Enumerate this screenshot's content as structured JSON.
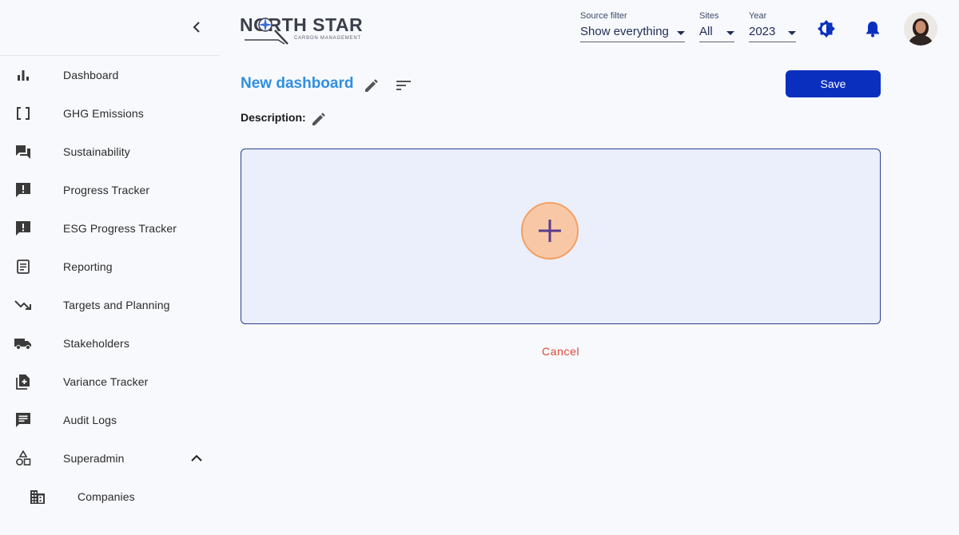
{
  "sidebar": {
    "items": [
      {
        "label": "Dashboard",
        "icon": "bar-chart-icon"
      },
      {
        "label": "GHG Emissions",
        "icon": "brackets-icon"
      },
      {
        "label": "Sustainability",
        "icon": "forum-icon"
      },
      {
        "label": "Progress Tracker",
        "icon": "feedback-icon"
      },
      {
        "label": "ESG Progress Tracker",
        "icon": "feedback-icon"
      },
      {
        "label": "Reporting",
        "icon": "document-icon"
      },
      {
        "label": "Targets and Planning",
        "icon": "trending-down-icon"
      },
      {
        "label": "Stakeholders",
        "icon": "truck-icon"
      },
      {
        "label": "Variance Tracker",
        "icon": "note-add-icon"
      },
      {
        "label": "Audit Logs",
        "icon": "message-icon"
      },
      {
        "label": "Superadmin",
        "icon": "shapes-icon",
        "expanded": true
      },
      {
        "label": "Companies",
        "icon": "building-icon",
        "sub": true
      }
    ]
  },
  "header": {
    "logo_text": "NORTH STAR",
    "logo_sub": "CARBON MANAGEMENT",
    "filters": {
      "source": {
        "label": "Source filter",
        "value": "Show everything"
      },
      "sites": {
        "label": "Sites",
        "value": "All"
      },
      "year": {
        "label": "Year",
        "value": "2023"
      }
    }
  },
  "main": {
    "title": "New dashboard",
    "save_label": "Save",
    "description_label": "Description:",
    "cancel_label": "Cancel"
  },
  "colors": {
    "accent": "#0a2fbf",
    "title": "#2f8fe0",
    "cancel": "#d9473a",
    "drop_area": "#ebeffc",
    "add_button": "#f8c8a6"
  }
}
